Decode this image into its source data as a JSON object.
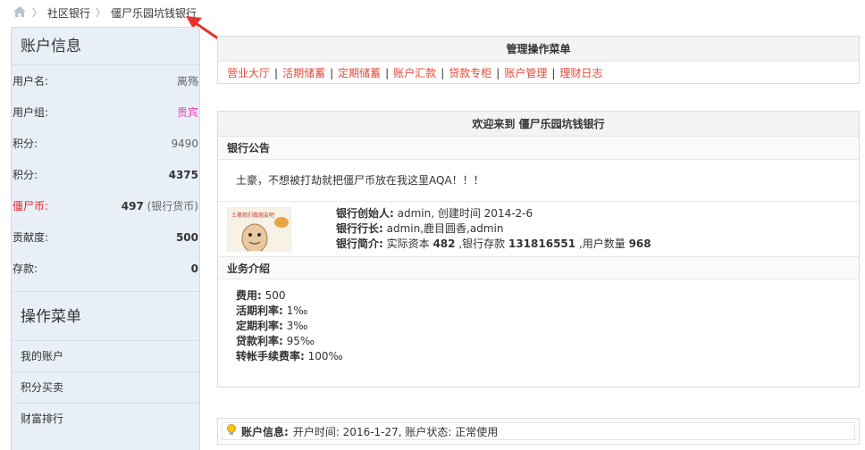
{
  "breadcrumb": {
    "home_icon": "home-icon",
    "items": [
      "社区银行",
      "僵尸乐园坑钱银行"
    ]
  },
  "sidebar": {
    "account_title": "账户信息",
    "rows": [
      {
        "key": "用户名:",
        "value": "离殇"
      },
      {
        "key": "用户组:",
        "value": "贵宾"
      },
      {
        "key": "积分:",
        "value": "9490"
      },
      {
        "key": "积分:",
        "value": "4375"
      },
      {
        "key": "僵尸币:",
        "value": "497",
        "suffix": " (银行货币)"
      },
      {
        "key": "贡献度:",
        "value": "500"
      },
      {
        "key": "存款:",
        "value": "0"
      }
    ],
    "menu_title": "操作菜单",
    "menu_items": [
      "我的账户",
      "积分买卖",
      "财富排行"
    ]
  },
  "manage": {
    "title": "管理操作菜单",
    "links": [
      "营业大厅",
      "活期储蓄",
      "定期储蓄",
      "账户汇款",
      "贷款专柜",
      "账户管理",
      "理财日志"
    ]
  },
  "welcome": {
    "title": "欢迎来到 僵尸乐园坑钱银行",
    "notice_title": "银行公告",
    "notice_text": "土豪，不想被打劫就把僵尸币放在我这里AQA！！！",
    "founder_label": "银行创始人:",
    "founder_value": " admin, 创建时间 2014-2-6",
    "president_label": "银行行长:",
    "president_value": " admin,鹿目圆香,admin",
    "intro_label": "银行简介:",
    "intro_prefix": " 实际资本 ",
    "capital": "482",
    "intro_mid": " ,银行存款 ",
    "deposits": "131816551",
    "intro_mid2": " ,用户数量 ",
    "users": "968",
    "image_caption": "土豪我们做朋友吧",
    "biz_title": "业务介绍",
    "biz": [
      {
        "label": "费用:",
        "value": " 500"
      },
      {
        "label": "活期利率:",
        "value": " 1‰"
      },
      {
        "label": "定期利率:",
        "value": " 3‰"
      },
      {
        "label": "贷款利率:",
        "value": " 95‰"
      },
      {
        "label": "转帐手续费率:",
        "value": " 100‰"
      }
    ]
  },
  "account_bar": {
    "label": "账户信息:",
    "text": " 开户时间: 2016-1-27, 账户状态: 正常使用"
  }
}
